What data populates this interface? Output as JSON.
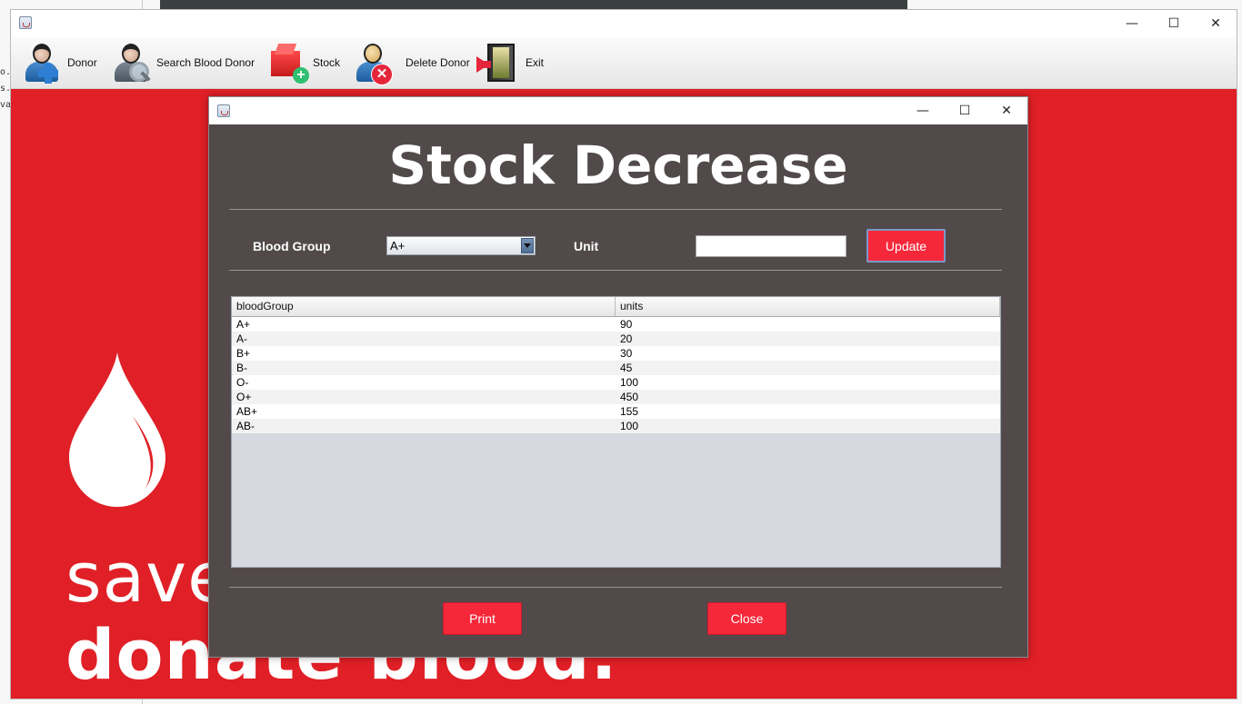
{
  "main_window": {
    "controls": {
      "minimize": "—",
      "maximize": "☐",
      "close": "✕"
    }
  },
  "toolbar": {
    "items": [
      {
        "label": "Donor",
        "icon": "add-donor-icon"
      },
      {
        "label": "Search Blood Donor",
        "icon": "search-donor-icon"
      },
      {
        "label": "Stock",
        "icon": "stock-icon"
      },
      {
        "label": "Delete Donor",
        "icon": "delete-donor-icon"
      },
      {
        "label": "Exit",
        "icon": "exit-icon"
      }
    ]
  },
  "background_ide": {
    "lines": [
      "o.ja",
      "s.ja",
      "va"
    ]
  },
  "poster": {
    "line1": "save",
    "line2": "donate blood.",
    "color": "#e01f26"
  },
  "dialog": {
    "controls": {
      "minimize": "—",
      "maximize": "☐",
      "close": "✕"
    },
    "heading": "Stock Decrease",
    "blood_group_label": "Blood Group",
    "blood_group_value": "A+",
    "unit_label": "Unit",
    "unit_value": "",
    "update_label": "Update",
    "print_label": "Print",
    "close_label": "Close",
    "accent": "#f5283a",
    "background": "#524a4a"
  },
  "table": {
    "columns": [
      "bloodGroup",
      "units"
    ],
    "rows": [
      [
        "A+",
        "90"
      ],
      [
        "A-",
        "20"
      ],
      [
        "B+",
        "30"
      ],
      [
        "B-",
        "45"
      ],
      [
        "O-",
        "100"
      ],
      [
        "O+",
        "450"
      ],
      [
        "AB+",
        "155"
      ],
      [
        "AB-",
        "100"
      ]
    ]
  }
}
